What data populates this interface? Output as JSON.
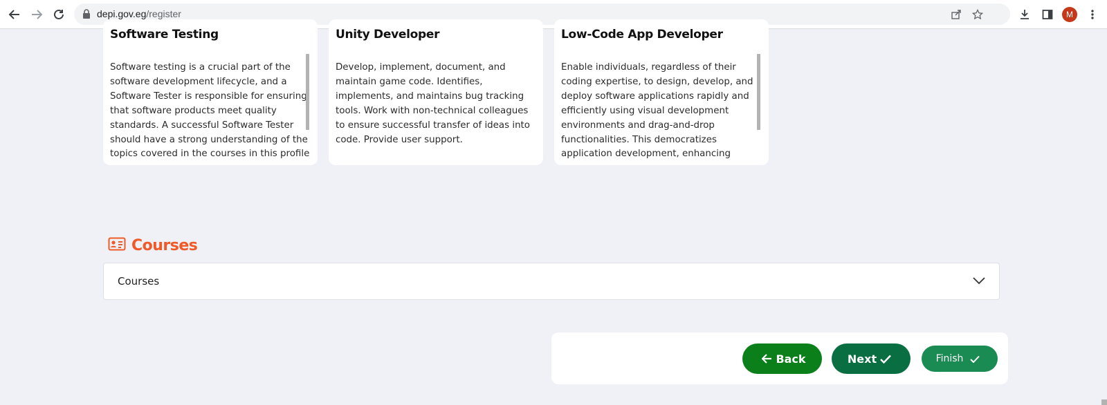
{
  "browser": {
    "url_domain": "depi.gov.eg",
    "url_path": "/register",
    "avatar_letter": "M",
    "icons": [
      "back-arrow-icon",
      "forward-arrow-icon",
      "reload-icon",
      "lock-icon",
      "share-icon",
      "star-icon",
      "download-icon",
      "side-panel-icon",
      "more-vert-icon"
    ]
  },
  "cards": [
    {
      "title": "Software Testing",
      "description": "Software testing is a crucial part of the software development lifecycle, and a Software Tester is responsible for ensuring that software products meet quality standards. A successful Software Tester should have a strong understanding of the topics covered in the courses in this profile"
    },
    {
      "title": "Unity Developer",
      "description": "Develop, implement, document, and maintain game code. Identifies, implements, and maintains bug tracking tools. Work with non-technical colleagues to ensure successful transfer of ideas into code. Provide user support."
    },
    {
      "title": "Low-Code App Developer",
      "description": "Enable individuals, regardless of their coding expertise, to design, develop, and deploy software applications rapidly and efficiently using visual development environments and drag-and-drop functionalities. This democratizes application development, enhancing"
    }
  ],
  "courses": {
    "section_title": "Courses",
    "select_value": "Courses"
  },
  "actions": {
    "back_label": "Back",
    "next_label": "Next",
    "finish_label": "Finish"
  },
  "colors": {
    "accent_orange": "#f05a28",
    "back_green": "#0a7f1a",
    "next_green": "#096f43",
    "finish_green": "#1a8b52"
  }
}
